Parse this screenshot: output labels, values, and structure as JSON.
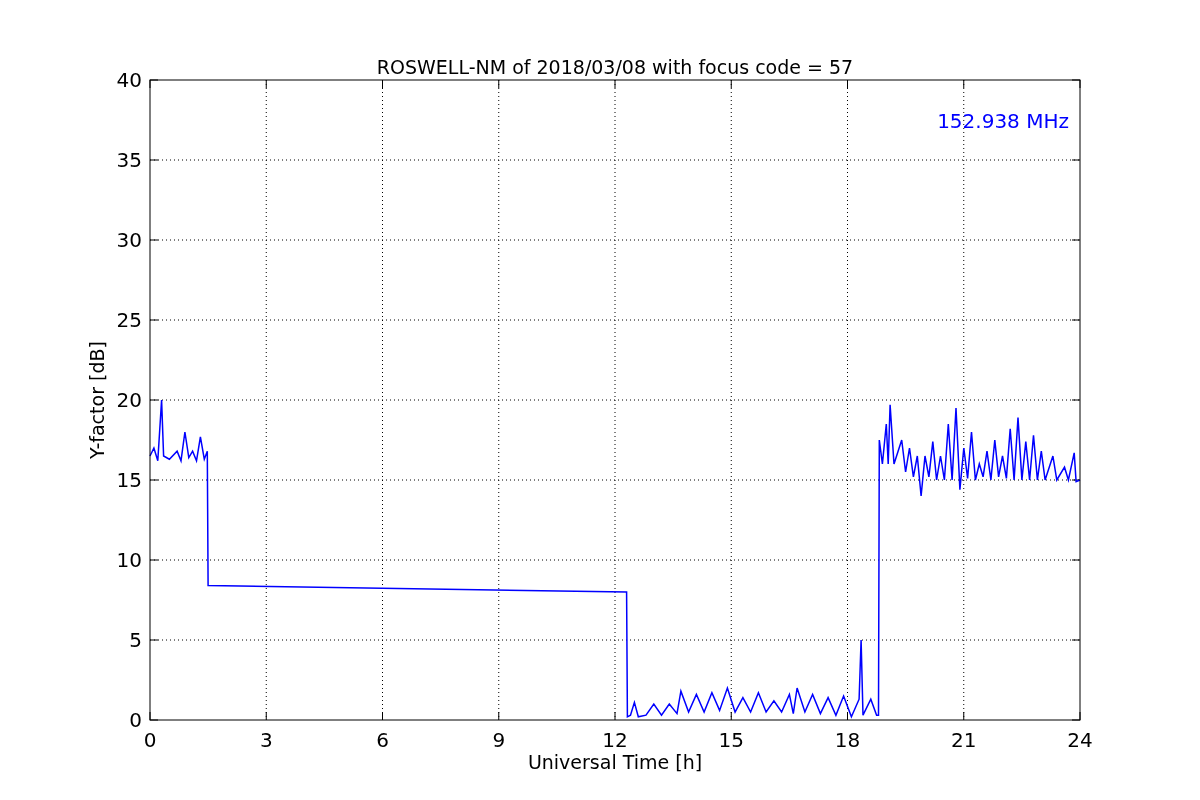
{
  "chart_data": {
    "type": "line",
    "title": "ROSWELL-NM of 2018/03/08 with focus code = 57",
    "xlabel": "Universal Time [h]",
    "ylabel": "Y-factor [dB]",
    "xlim": [
      0,
      24
    ],
    "ylim": [
      0,
      40
    ],
    "grid": true,
    "xticks": [
      0,
      3,
      6,
      9,
      12,
      15,
      18,
      21,
      24
    ],
    "yticks": [
      0,
      5,
      10,
      15,
      20,
      25,
      30,
      35,
      40
    ],
    "x": [
      0,
      0.1,
      0.2,
      0.3,
      0.35,
      0.5,
      0.7,
      0.8,
      0.9,
      1.0,
      1.1,
      1.2,
      1.3,
      1.4,
      1.48,
      1.5,
      12.3,
      12.32,
      12.4,
      12.5,
      12.6,
      12.8,
      13.0,
      13.2,
      13.4,
      13.6,
      13.7,
      13.9,
      14.1,
      14.3,
      14.5,
      14.7,
      14.9,
      15.1,
      15.3,
      15.5,
      15.7,
      15.9,
      16.1,
      16.3,
      16.5,
      16.6,
      16.7,
      16.9,
      17.1,
      17.3,
      17.5,
      17.7,
      17.9,
      18.1,
      18.3,
      18.35,
      18.4,
      18.6,
      18.75,
      18.8,
      18.82,
      18.9,
      19.0,
      19.05,
      19.1,
      19.2,
      19.4,
      19.5,
      19.6,
      19.7,
      19.8,
      19.9,
      20.0,
      20.1,
      20.2,
      20.3,
      20.4,
      20.5,
      20.6,
      20.7,
      20.8,
      20.9,
      21.0,
      21.1,
      21.2,
      21.3,
      21.4,
      21.5,
      21.6,
      21.7,
      21.8,
      21.9,
      22.0,
      22.1,
      22.2,
      22.3,
      22.4,
      22.5,
      22.6,
      22.7,
      22.8,
      22.9,
      23.0,
      23.1,
      23.3,
      23.4,
      23.6,
      23.7,
      23.85,
      23.9,
      24.0
    ],
    "series": [
      {
        "name": "152.938 MHz",
        "color": "#0000ff",
        "values": [
          16.5,
          17,
          16.2,
          20,
          16.5,
          16.3,
          16.8,
          16.2,
          18,
          16.4,
          16.8,
          16.2,
          17.7,
          16.3,
          16.8,
          8.4,
          8.0,
          0.2,
          0.3,
          1.1,
          0.2,
          0.3,
          1.0,
          0.3,
          1.0,
          0.4,
          1.8,
          0.5,
          1.6,
          0.5,
          1.7,
          0.6,
          2.0,
          0.5,
          1.4,
          0.5,
          1.7,
          0.5,
          1.2,
          0.5,
          1.6,
          0.4,
          2.0,
          0.5,
          1.6,
          0.4,
          1.4,
          0.3,
          1.5,
          0.2,
          1.3,
          5.0,
          0.3,
          1.3,
          0.3,
          0.3,
          17.5,
          16,
          18.5,
          16,
          19.7,
          16,
          17.5,
          15.5,
          17,
          15.2,
          16.5,
          14,
          16.5,
          15.2,
          17.4,
          15,
          16.5,
          15,
          18.5,
          15,
          19.5,
          14.4,
          17,
          15.1,
          18,
          15,
          16,
          15.2,
          16.8,
          15,
          17.5,
          15.2,
          16.5,
          15.1,
          18.2,
          15,
          18.9,
          15,
          17.4,
          15,
          17.8,
          15,
          16.8,
          15,
          16.5,
          15,
          15.8,
          15,
          16.7,
          14.9,
          15
        ]
      }
    ]
  }
}
